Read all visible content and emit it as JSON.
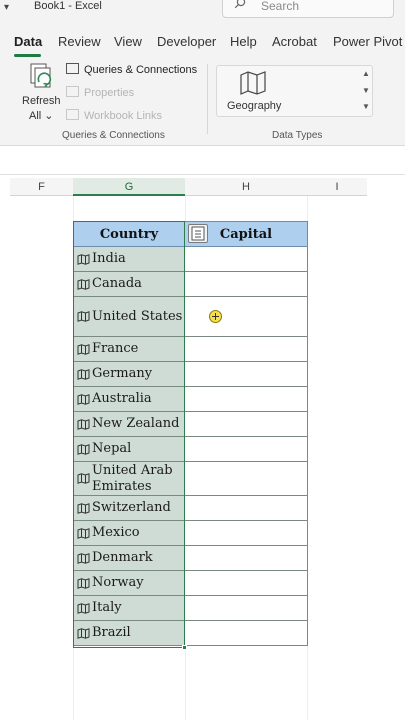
{
  "titlebar": {
    "quick_access": "▾",
    "title": "Book1  -  Excel"
  },
  "search": {
    "placeholder": "Search"
  },
  "tabs": [
    {
      "label": "Data",
      "active": true
    },
    {
      "label": "Review"
    },
    {
      "label": "View"
    },
    {
      "label": "Developer"
    },
    {
      "label": "Help"
    },
    {
      "label": "Acrobat"
    },
    {
      "label": "Power Pivot"
    }
  ],
  "ribbon": {
    "refresh_label": "Refresh",
    "refresh_sub": "All ⌄",
    "queries_connections": "Queries & Connections",
    "properties": "Properties",
    "workbook_links": "Workbook Links",
    "group_queries": "Queries & Connections",
    "data_type": "Geography",
    "group_data_types": "Data Types"
  },
  "columns": [
    "F",
    "G",
    "H",
    "I"
  ],
  "table": {
    "headers": [
      "Country",
      "Capital"
    ],
    "rows": [
      "India",
      "Canada",
      "United States",
      "France",
      "Germany",
      "Australia",
      "New Zealand",
      "Nepal",
      "United Arab Emirates",
      "Switzerland",
      "Mexico",
      "Denmark",
      "Norway",
      "Italy",
      "Brazil"
    ]
  },
  "colors": {
    "header_fill": "#aed0ee",
    "country_fill": "#cfdcd5",
    "accent": "#1f7a43"
  },
  "icons": [
    "search-icon",
    "refresh-icon",
    "geography-map-icon",
    "map-icon",
    "insert-data-icon"
  ]
}
